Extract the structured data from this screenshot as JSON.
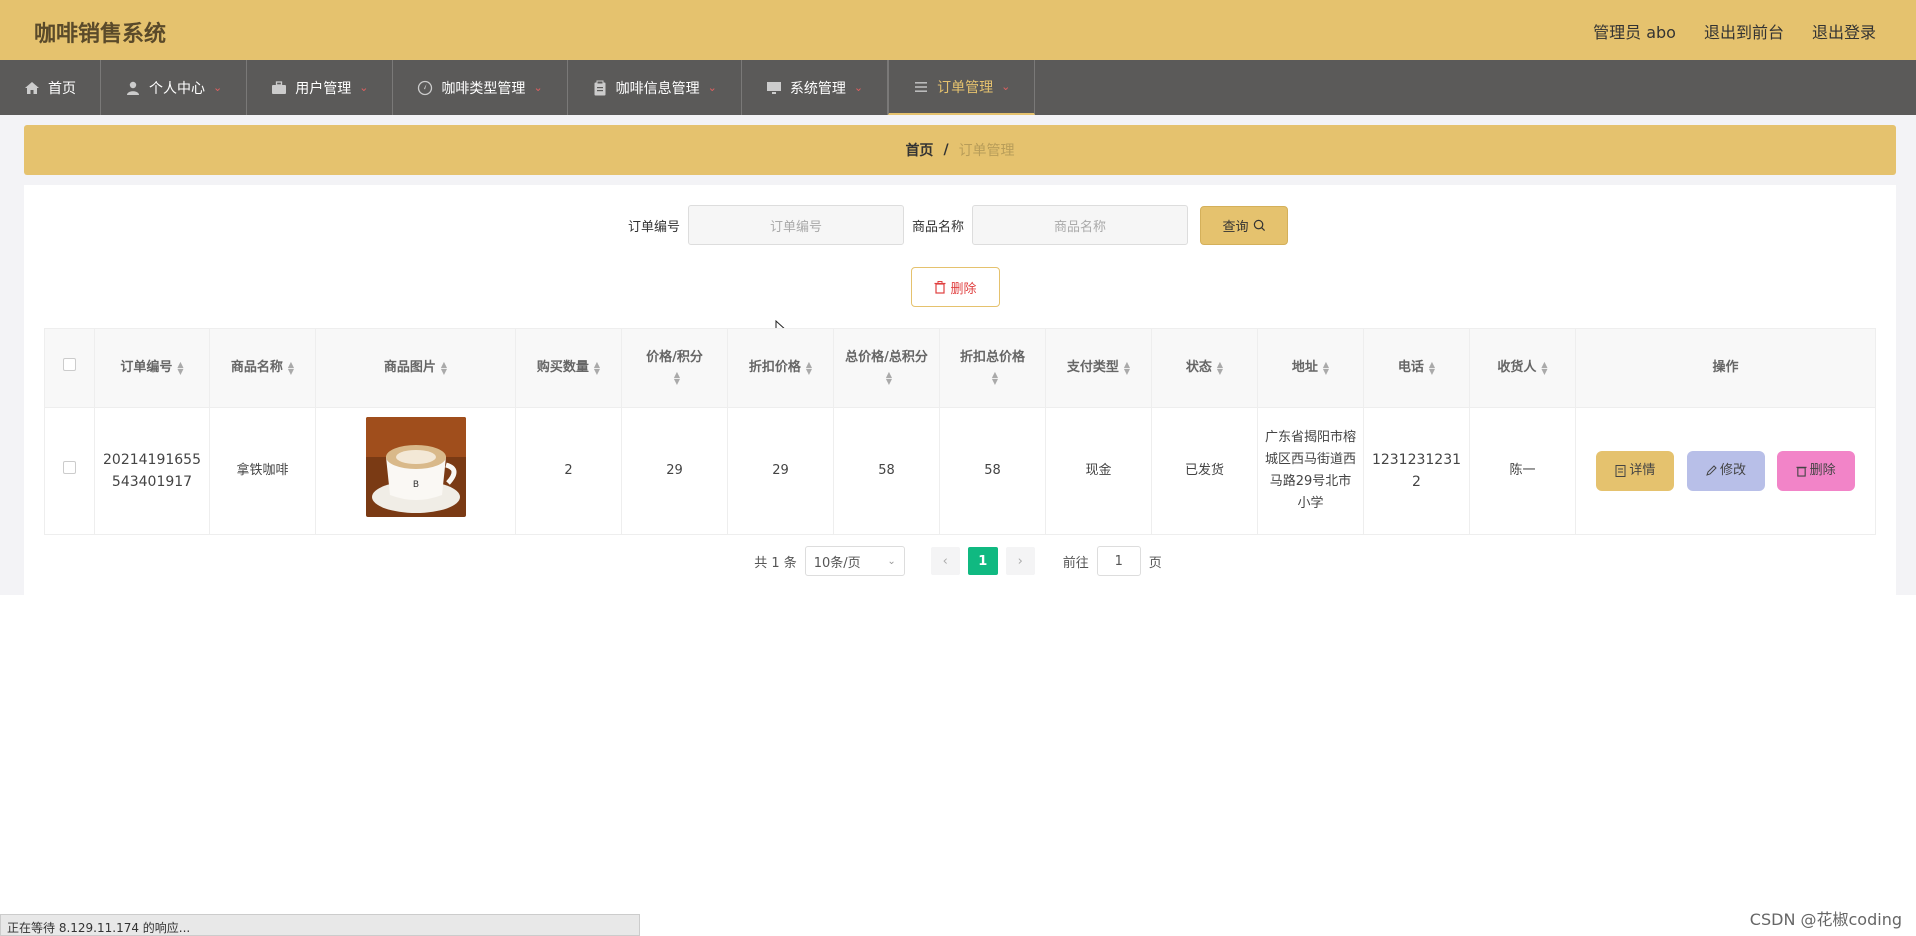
{
  "app": {
    "title": "咖啡销售系统"
  },
  "header": {
    "admin": "管理员 abo",
    "front": "退出到前台",
    "logout": "退出登录"
  },
  "nav": [
    {
      "label": "首页",
      "icon": "home-icon"
    },
    {
      "label": "个人中心",
      "icon": "user-icon"
    },
    {
      "label": "用户管理",
      "icon": "briefcase-icon"
    },
    {
      "label": "咖啡类型管理",
      "icon": "compass-icon"
    },
    {
      "label": "咖啡信息管理",
      "icon": "clipboard-icon"
    },
    {
      "label": "系统管理",
      "icon": "monitor-icon"
    },
    {
      "label": "订单管理",
      "icon": "list-icon"
    }
  ],
  "breadcrumb": {
    "home": "首页",
    "sep": "/",
    "current": "订单管理"
  },
  "search": {
    "order_label": "订单编号",
    "order_placeholder": "订单编号",
    "product_label": "商品名称",
    "product_placeholder": "商品名称",
    "query_label": "查询"
  },
  "bulk_delete": "删除",
  "table": {
    "headers": {
      "order_no": "订单编号",
      "product": "商品名称",
      "image": "商品图片",
      "qty": "购买数量",
      "price": "价格/积分",
      "discount_price": "折扣价格",
      "total": "总价格/总积分",
      "discount_total": "折扣总价格",
      "pay_type": "支付类型",
      "status": "状态",
      "address": "地址",
      "phone": "电话",
      "receiver": "收货人",
      "ops": "操作"
    },
    "rows": [
      {
        "order_no": "20214191655543401917",
        "product": "拿铁咖啡",
        "qty": "2",
        "price": "29",
        "discount_price": "29",
        "total": "58",
        "discount_total": "58",
        "pay_type": "现金",
        "status": "已发货",
        "address": "广东省揭阳市榕城区西马街道西马路29号北市小学",
        "phone": "12312312312",
        "receiver": "陈一"
      }
    ],
    "actions": {
      "detail": "详情",
      "edit": "修改",
      "delete": "删除"
    }
  },
  "pagination": {
    "total": "共 1 条",
    "page_size": "10条/页",
    "current": "1",
    "goto": "前往",
    "goto_value": "1",
    "page_unit": "页"
  },
  "statusbar": "正在等待 8.129.11.174 的响应...",
  "watermark": "CSDN @花椒coding",
  "colors": {
    "header": "#e5c26e",
    "nav": "#5b5a59",
    "detail_btn": "#e5c26e",
    "edit_btn": "#b8bfe8",
    "delete_btn": "#f284c8",
    "page_active": "#10b981"
  }
}
